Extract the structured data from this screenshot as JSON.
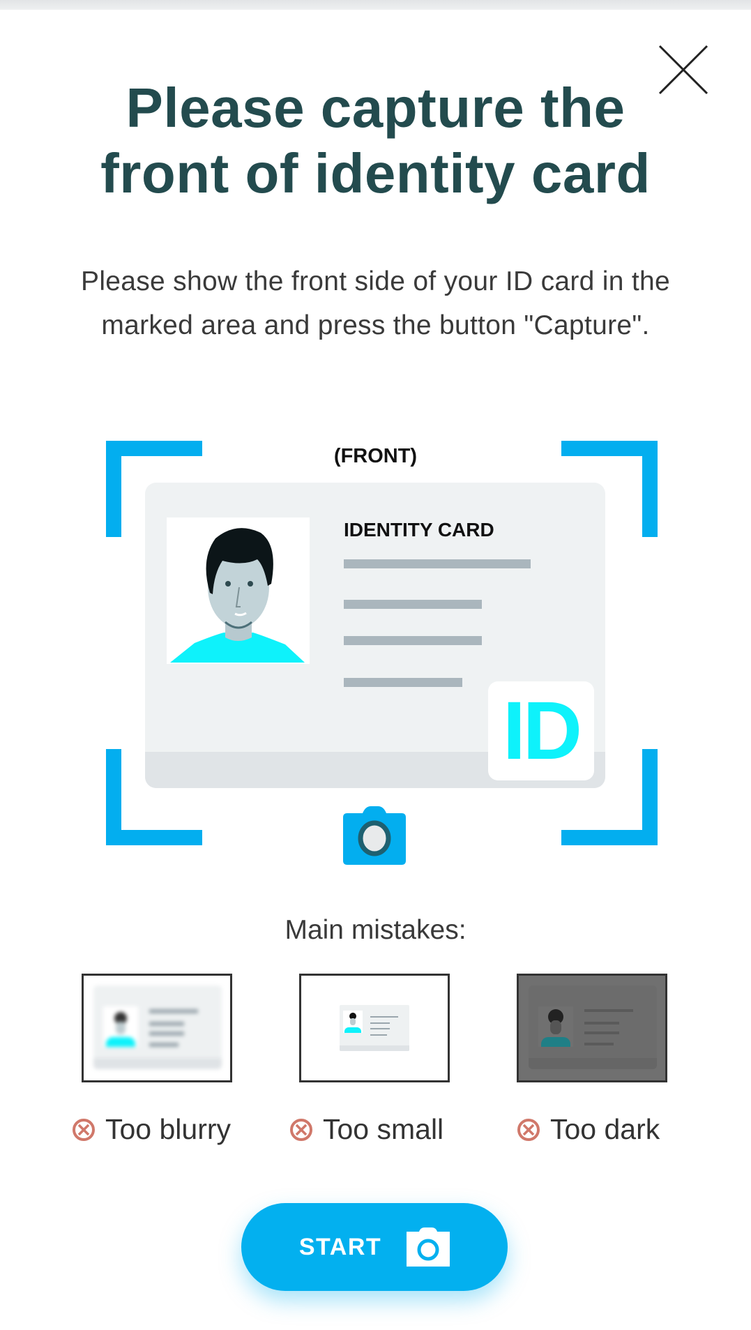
{
  "header": {
    "title": "Please capture the front of identity card",
    "close_icon": "close-icon"
  },
  "instructions": {
    "text": "Please show the front side of your ID card in the marked area and press the button \"Capture\"."
  },
  "illustration": {
    "side_label": "(FRONT)",
    "card_heading": "IDENTITY CARD",
    "badge_text": "ID",
    "camera_icon": "camera-icon",
    "colors": {
      "frame": "#03aeef",
      "badge_text": "#0ef2fb",
      "shirt": "#0ef2fb"
    }
  },
  "mistakes": {
    "heading": "Main mistakes:",
    "items": [
      {
        "label": "Too blurry",
        "icon": "error-x-circle-icon"
      },
      {
        "label": "Too small",
        "icon": "error-x-circle-icon"
      },
      {
        "label": "Too dark",
        "icon": "error-x-circle-icon"
      }
    ],
    "icon_color": "#d0786a"
  },
  "actions": {
    "start_label": "START",
    "start_icon": "camera-icon",
    "accent": "#03b0ef"
  }
}
